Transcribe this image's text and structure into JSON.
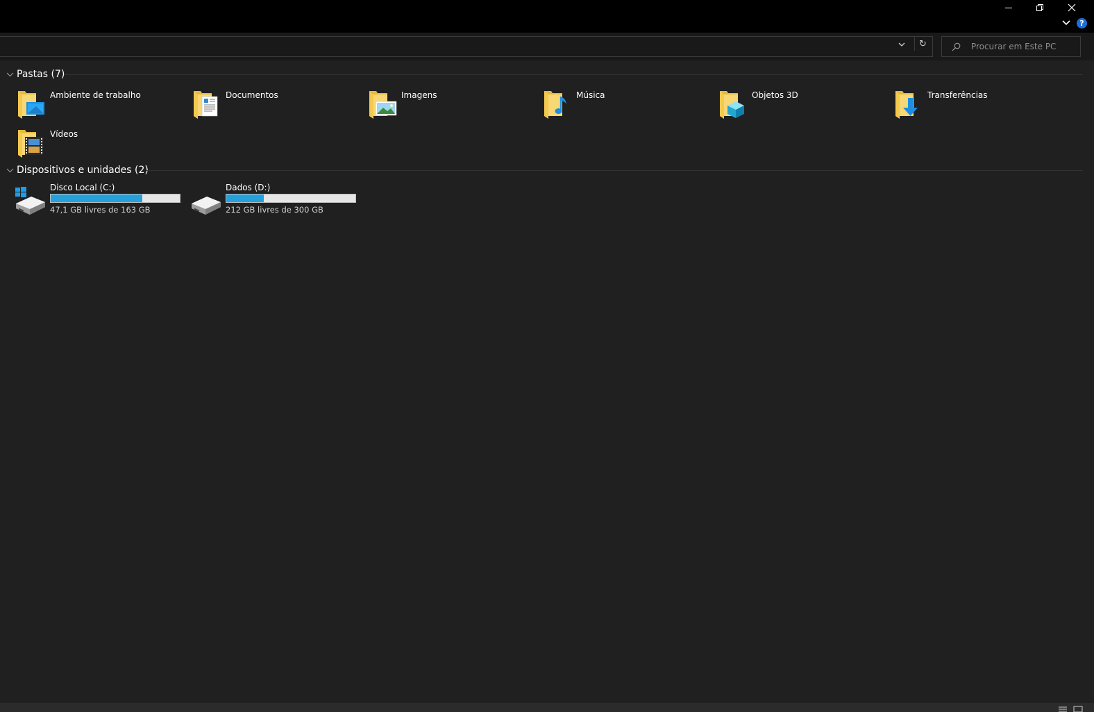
{
  "window": {
    "minimize_icon": "minimize-icon",
    "restore_icon": "restore-icon",
    "close_icon": "close-icon",
    "help_label": "?"
  },
  "addressbar": {
    "refresh_glyph": "↻"
  },
  "search": {
    "placeholder": "Procurar em Este PC"
  },
  "folders_group": {
    "title": "Pastas (7)",
    "items": [
      {
        "label": "Ambiente de trabalho",
        "icon": "desktop-folder-icon"
      },
      {
        "label": "Documentos",
        "icon": "documents-folder-icon"
      },
      {
        "label": "Imagens",
        "icon": "pictures-folder-icon"
      },
      {
        "label": "Música",
        "icon": "music-folder-icon"
      },
      {
        "label": "Objetos 3D",
        "icon": "3d-objects-folder-icon"
      },
      {
        "label": "Transferências",
        "icon": "downloads-folder-icon"
      },
      {
        "label": "Vídeos",
        "icon": "videos-folder-icon"
      }
    ]
  },
  "drives_group": {
    "title": "Dispositivos e unidades (2)",
    "items": [
      {
        "label": "Disco Local (C:)",
        "free_text": "47,1 GB livres de 163 GB",
        "used_fraction": 0.71,
        "icon": "windows-drive-icon"
      },
      {
        "label": "Dados (D:)",
        "free_text": "212 GB livres de 300 GB",
        "used_fraction": 0.29,
        "icon": "hard-drive-icon"
      }
    ]
  },
  "colors": {
    "background": "#202020",
    "titlebar": "#000000",
    "folder_yellow": "#f8d775",
    "accent_blue": "#26a0da",
    "drive_bar_bg": "#e6e6e6"
  }
}
